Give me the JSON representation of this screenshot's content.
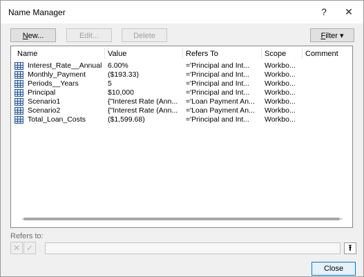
{
  "window": {
    "title": "Name Manager",
    "help_glyph": "?",
    "close_glyph": "✕"
  },
  "toolbar": {
    "new_label": "New...",
    "edit_label": "Edit...",
    "delete_label": "Delete",
    "filter_label": "Filter",
    "filter_arrow": "▾"
  },
  "columns": {
    "name": "Name",
    "value": "Value",
    "refers_to": "Refers To",
    "scope": "Scope",
    "comment": "Comment"
  },
  "rows": [
    {
      "name": "Interest_Rate__Annual",
      "value": "6.00%",
      "refers_to": "='Principal and Int...",
      "scope": "Workbo...",
      "comment": ""
    },
    {
      "name": "Monthly_Payment",
      "value": "($193.33)",
      "refers_to": "='Principal and Int...",
      "scope": "Workbo...",
      "comment": ""
    },
    {
      "name": "Periods__Years",
      "value": "5",
      "refers_to": "='Principal and Int...",
      "scope": "Workbo...",
      "comment": ""
    },
    {
      "name": "Principal",
      "value": "$10,000",
      "refers_to": "='Principal and Int...",
      "scope": "Workbo...",
      "comment": ""
    },
    {
      "name": "Scenario1",
      "value": "{\"Interest Rate (Ann...",
      "refers_to": "='Loan Payment An...",
      "scope": "Workbo...",
      "comment": ""
    },
    {
      "name": "Scenario2",
      "value": "{\"Interest Rate (Ann...",
      "refers_to": "='Loan Payment An...",
      "scope": "Workbo...",
      "comment": ""
    },
    {
      "name": "Total_Loan_Costs",
      "value": "($1,599.68)",
      "refers_to": "='Principal and Int...",
      "scope": "Workbo...",
      "comment": ""
    }
  ],
  "refers": {
    "label": "Refers to:",
    "value": "",
    "cancel_glyph": "✕",
    "accept_glyph": "✓",
    "collapse_glyph": "⭱"
  },
  "footer": {
    "close_label": "Close"
  }
}
